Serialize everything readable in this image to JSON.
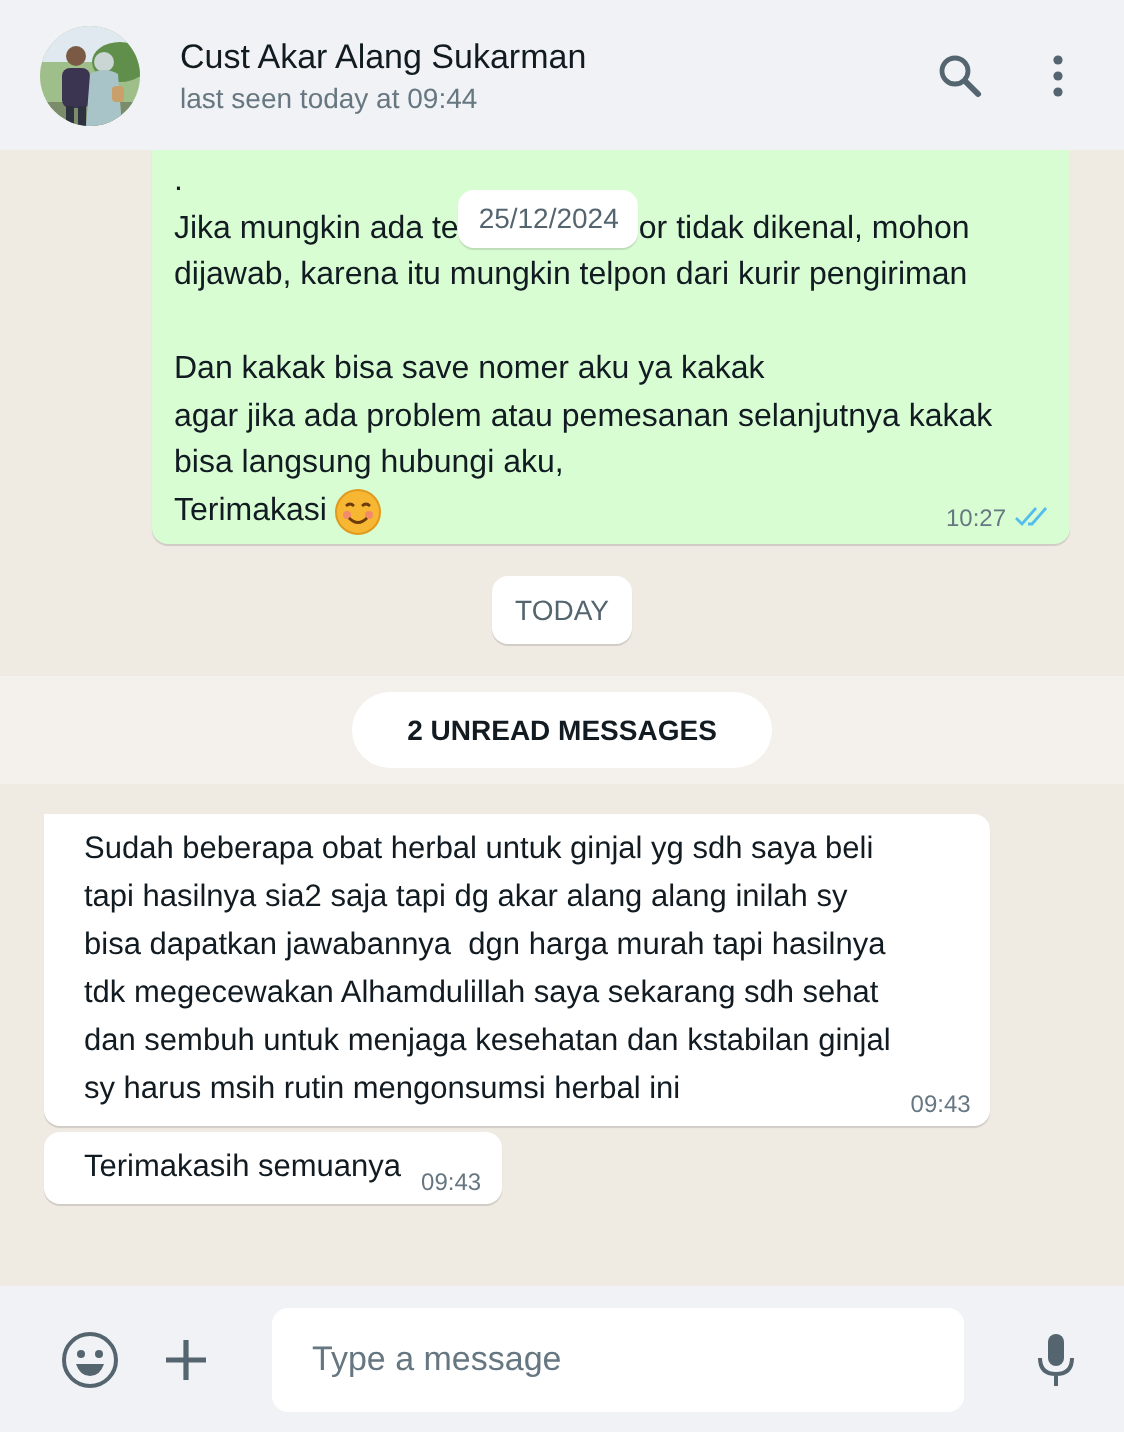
{
  "header": {
    "contact_name": "Cust Akar Alang Sukarman",
    "last_seen": "last seen today at 09:44"
  },
  "messages": [
    {
      "kind": "outgoing",
      "paragraphs": [
        [
          ".",
          {
            "before": "Jika mungkin ada te",
            "chip": "25/12/2024",
            "after": "or tidak dikenal, mohon"
          },
          "dijawab, karena itu mungkin telpon dari kurir pengiriman"
        ],
        [
          "Dan kakak bisa save nomer aku ya kakak",
          "agar jika ada problem atau pemesanan selanjutnya kakak",
          "bisa langsung hubungi aku,",
          "Terimakasi"
        ]
      ],
      "time": "10:27",
      "read": true
    },
    {
      "kind": "day",
      "label": "TODAY"
    },
    {
      "kind": "unread",
      "label": "2 UNREAD MESSAGES"
    },
    {
      "kind": "incoming",
      "tail": true,
      "lines": [
        "Sudah beberapa obat herbal untuk ginjal yg sdh saya beli",
        "tapi hasilnya sia2 saja tapi dg akar alang alang inilah sy",
        "bisa dapatkan jawabannya  dgn harga murah tapi hasilnya",
        "tdk megecewakan Alhamdulillah saya sekarang sdh sehat",
        "dan sembuh untuk menjaga kesehatan dan kstabilan ginjal",
        "sy harus msih rutin mengonsumsi herbal ini"
      ],
      "time": "09:43"
    },
    {
      "kind": "incoming",
      "tail": false,
      "lines": [
        "Terimakasih semuanya"
      ],
      "time": "09:43"
    }
  ],
  "composer": {
    "placeholder": "Type a message"
  }
}
